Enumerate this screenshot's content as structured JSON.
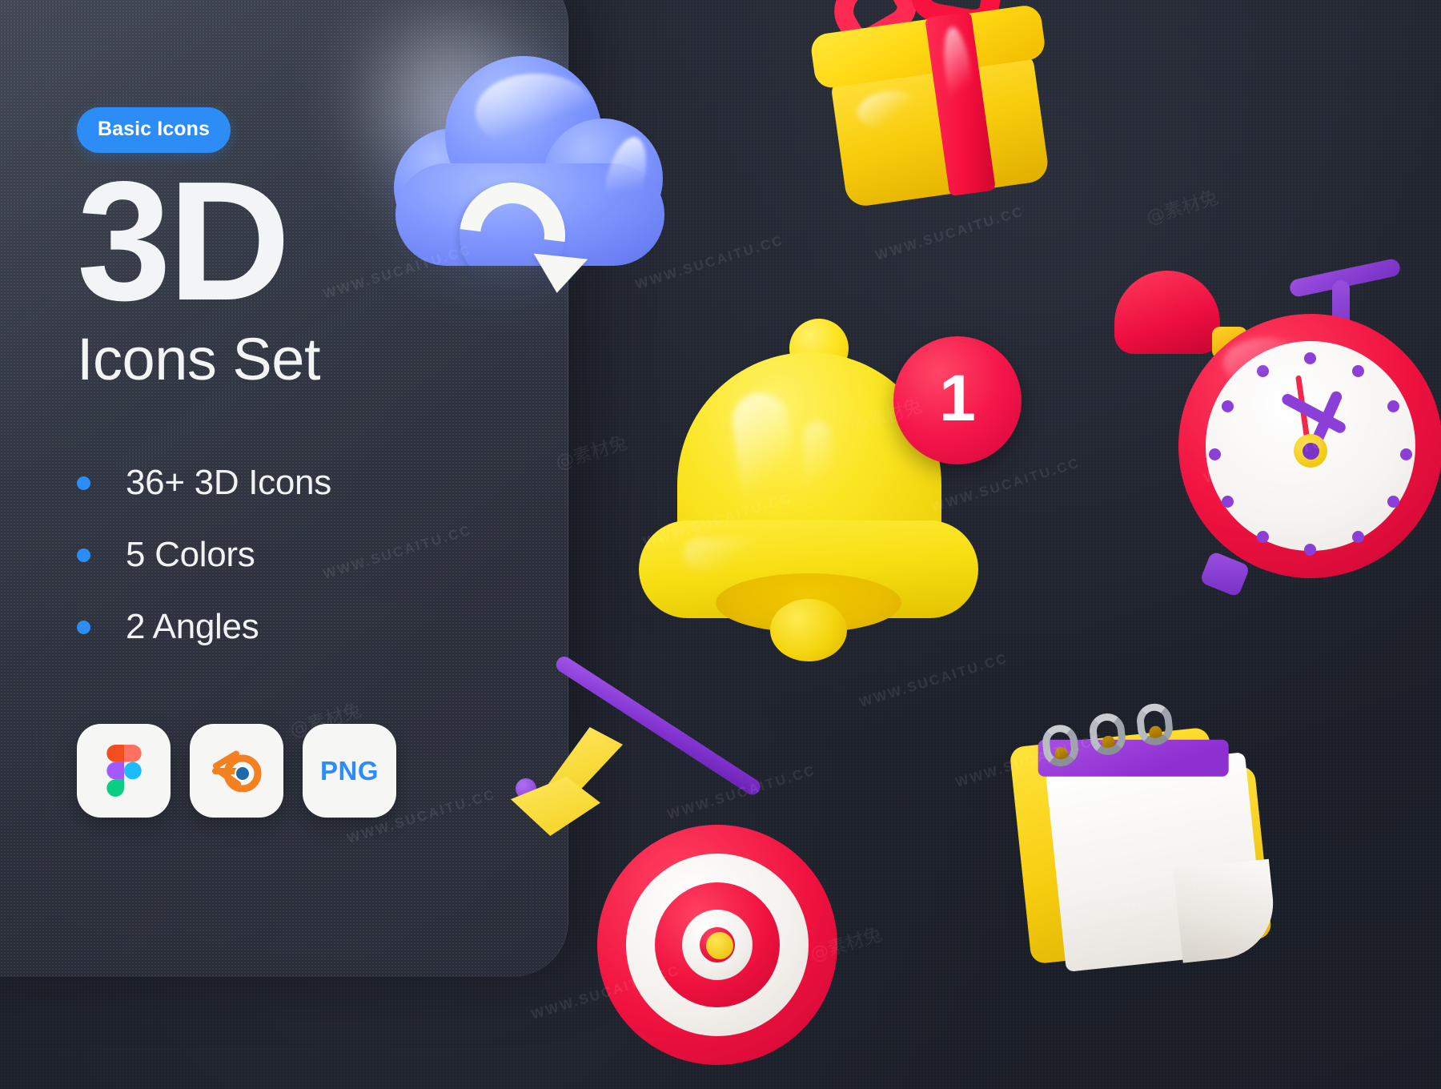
{
  "meta": {
    "background_color": "#20242E",
    "accent_blue": "#2C8DF7",
    "text_light": "#F2F4F6"
  },
  "panel": {
    "badge_label": "Basic Icons",
    "title": "3D",
    "subtitle": "Icons Set",
    "features": [
      {
        "label": "36+ 3D Icons"
      },
      {
        "label": "5 Colors"
      },
      {
        "label": "2 Angles"
      }
    ],
    "formats": [
      {
        "name": "figma-badge",
        "label": ""
      },
      {
        "name": "blender-badge",
        "label": ""
      },
      {
        "name": "png-badge",
        "label": "PNG"
      }
    ]
  },
  "icons": [
    {
      "name": "cloud-download-icon",
      "colors": [
        "#8096FE",
        "#F7F7F4"
      ]
    },
    {
      "name": "gift-box-icon",
      "colors": [
        "#FFD814",
        "#F5174A"
      ]
    },
    {
      "name": "notification-bell-icon",
      "colors": [
        "#FBE522",
        "#F5174A"
      ]
    },
    {
      "name": "alarm-clock-icon",
      "colors": [
        "#F0123F",
        "#8B3FD6",
        "#FFFFFF"
      ]
    },
    {
      "name": "target-arrow-icon",
      "colors": [
        "#F3264C",
        "#8233D0",
        "#F3D01E"
      ]
    },
    {
      "name": "calendar-icon",
      "colors": [
        "#F8CE10",
        "#8E2FD1",
        "#FFFFFF"
      ]
    }
  ],
  "bell_badge": {
    "count": "1",
    "color": "#F5174A"
  },
  "watermarks": {
    "url": "WWW.SUCAITU.CC",
    "handle": "@素材兔"
  }
}
